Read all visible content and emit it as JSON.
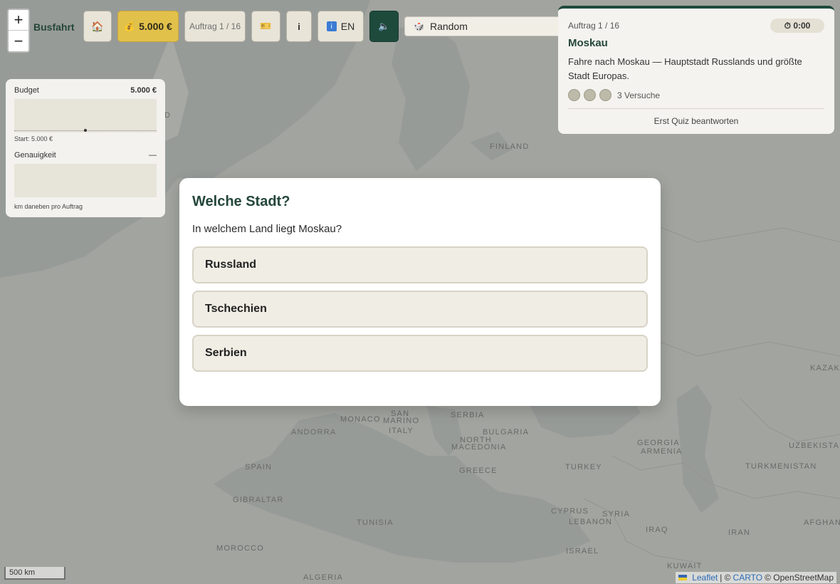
{
  "toolbar": {
    "zoom_in": "+",
    "zoom_out": "−",
    "brand": "Busfahrt",
    "home_icon": "house-icon",
    "budget_icon": "money-bag-icon",
    "budget": "5.000 €",
    "task_counter": "Auftrag 1 / 16",
    "ticket_icon": "ticket-icon",
    "info": "i",
    "lang_icon": "info-icon",
    "lang": "EN",
    "sound_icon": "speaker-icon",
    "mode_icon": "dice-icon",
    "mode": "Random"
  },
  "stats": {
    "budget_label": "Budget",
    "budget_value": "5.000 €",
    "budget_start": "Start: 5.000 €",
    "accuracy_label": "Genauigkeit",
    "accuracy_value": "—",
    "accuracy_unit": "km daneben pro Auftrag"
  },
  "task": {
    "counter": "Auftrag 1 / 16",
    "timer": "⏱ 0:00",
    "city": "Moskau",
    "description": "Fahre nach Moskau — Hauptstadt Russlands und größte Stadt Europas.",
    "tries_total": 3,
    "tries_label": "3 Versuche",
    "action": "Erst Quiz beantworten"
  },
  "quiz": {
    "title": "Welche Stadt?",
    "question": "In welchem Land liegt Moskau?",
    "answers": [
      "Russland",
      "Tschechien",
      "Serbien"
    ]
  },
  "map": {
    "labels": [
      {
        "text": "FINLAND"
      },
      {
        "text": "D"
      },
      {
        "text": "MONACO"
      },
      {
        "text": "SAN"
      },
      {
        "text": "MARINO"
      },
      {
        "text": "ANDORRA"
      },
      {
        "text": "ITALY"
      },
      {
        "text": "SERBIA"
      },
      {
        "text": "BULGARIA"
      },
      {
        "text": "NORTH"
      },
      {
        "text": "MACEDONIA"
      },
      {
        "text": "GEORGIA"
      },
      {
        "text": "ARMENIA"
      },
      {
        "text": "UZBEKISTAN"
      },
      {
        "text": "KAZAK"
      },
      {
        "text": "SPAIN"
      },
      {
        "text": "GREECE"
      },
      {
        "text": "TURKEY"
      },
      {
        "text": "TURKMENISTAN"
      },
      {
        "text": "GIBRALTAR"
      },
      {
        "text": "TUNISIA"
      },
      {
        "text": "CYPRUS"
      },
      {
        "text": "SYRIA"
      },
      {
        "text": "LEBANON"
      },
      {
        "text": "AFGHAN"
      },
      {
        "text": "IRAQ"
      },
      {
        "text": "IRAN"
      },
      {
        "text": "ISRAEL"
      },
      {
        "text": "MOROCCO"
      },
      {
        "text": "KUWAIT"
      },
      {
        "text": "ALGERIA"
      }
    ]
  },
  "footer": {
    "scale": "500 km",
    "leaflet": "Leaflet",
    "sep1": "| ©",
    "carto": "CARTO",
    "osm": "© OpenStreetMap"
  }
}
